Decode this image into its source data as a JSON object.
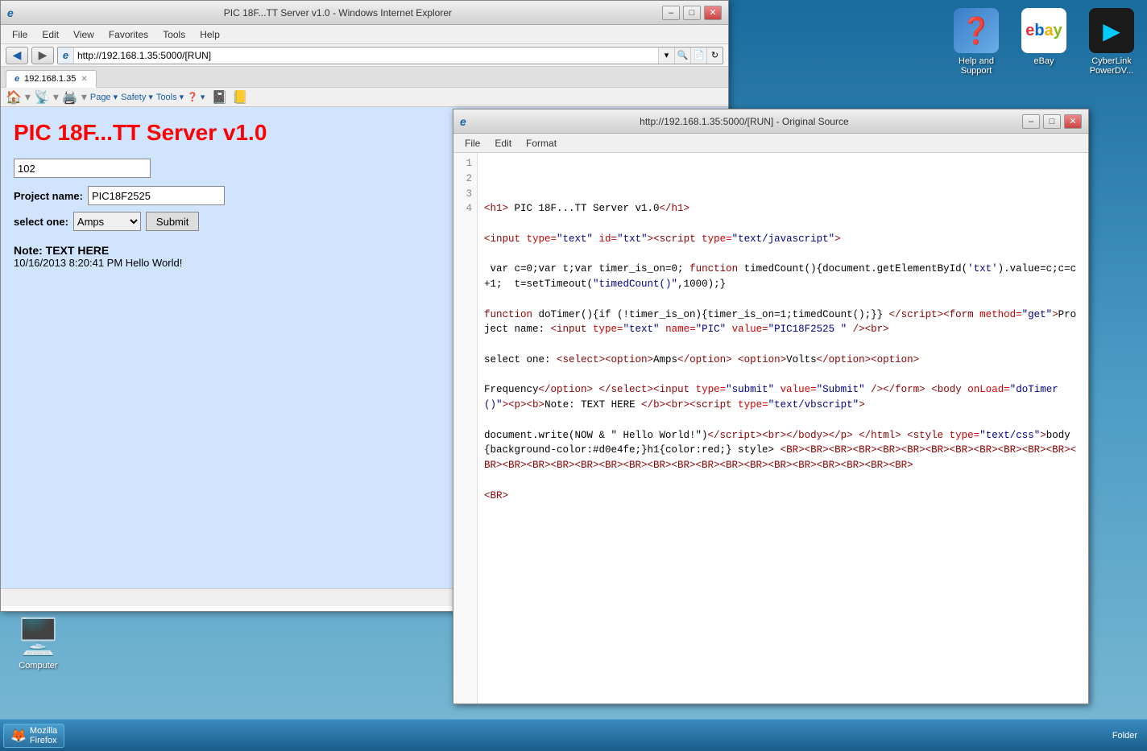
{
  "desktop": {
    "icons_top": [
      {
        "id": "help-support",
        "label": "Help and\nSupport",
        "emoji": "❓",
        "bg": "#3a7cc7"
      },
      {
        "id": "ebay",
        "label": "eBay",
        "text": "eBay",
        "bg": "#fff"
      },
      {
        "id": "cyberlink",
        "label": "CyberLink\nPowerDV...",
        "emoji": "▶",
        "bg": "#1a1a1a"
      }
    ],
    "icon_bottom": {
      "label": "Computer"
    }
  },
  "browser": {
    "title": "PIC 18F...TT Server v1.0 - Windows Internet Explorer",
    "url": "http://192.168.1.35:5000/[RUN]",
    "tab1_label": "192.168.1.35",
    "menu": [
      "File",
      "Edit",
      "View",
      "Favorites",
      "Tools",
      "Help"
    ],
    "fav_bar": [
      "Page ▾",
      "Safety ▾",
      "Tools ▾",
      "❓ ▾"
    ],
    "page": {
      "title": "PIC 18F...TT Server v1.0",
      "counter": "102",
      "project_label": "Project name:",
      "project_value": "PIC18F2525",
      "select_label": "select one:",
      "select_option": "Amps",
      "submit_label": "Submit",
      "note_label": "Note: TEXT HERE",
      "note_date": "10/16/2013 8:20:41 PM Hello World!"
    }
  },
  "source": {
    "title": "http://192.168.1.35:5000/[RUN] - Original Source",
    "menu": [
      "File",
      "Edit",
      "Format"
    ],
    "lines": [
      {
        "num": 1,
        "html": ""
      },
      {
        "num": 2,
        "html": "&lt;h1&gt; PIC 18F...TT Server v1.0&lt;/h1&gt;"
      },
      {
        "num": 3,
        "html": "&lt;input type=&quot;text&quot; id=&quot;txt&quot;&gt;&lt;script type=&quot;text/javascript&quot;&gt;"
      },
      {
        "num": 4,
        "html": " var c=0;var t;var timer_is_on=0; function timedCount(){document.getElementById(&apos;txt&apos;).value=c;c=c+1;  t=setTimeout(&quot;timedCount()&quot;,1000);}function doTimer(){if (!timer_is_on){timer_is_on=1;timedCount();}} &lt;/script&gt;&lt;form method=&quot;get&quot;&gt;Project name: &lt;input type=&quot;text&quot; name=&quot;PIC&quot; value=&quot;PIC18F2525 &quot; /&gt;&lt;br&gt;select one: &lt;select&gt;&lt;option&gt;Amps&lt;/option&gt; &lt;option&gt;Volts&lt;/option&gt;&lt;option&gt;Frequency&lt;/option&gt; &lt;/select&gt;&lt;input type=&quot;submit&quot; value=&quot;Submit&quot; /&gt;&lt;/form&gt; &lt;body onLoad=&quot;doTimer()&quot;&gt;&lt;p&gt;&lt;b&gt;Note: TEXT HERE &lt;/b&gt;&lt;br&gt;&lt;script type=&quot;text/vbscript&quot;&gt;document.write(NOW &amp; &quot; Hello World!&quot;)&lt;/script&gt;&lt;br&gt;&lt;/body&gt;&lt;/p&gt; &lt;/html&gt; &lt;style type=&quot;text/css&quot;&gt;body{background-color:#d0e4fe;}h1{color:red;} style&gt; &lt;BR&gt;&lt;BR&gt;&lt;BR&gt;&lt;BR&gt;&lt;BR&gt;&lt;BR&gt;&lt;BR&gt;&lt;BR&gt;&lt;BR&gt;&lt;BR&gt;&lt;BR&gt;&lt;BR&gt;&lt;BR&gt;&lt;BR&gt;&lt;BR&gt;&lt;BR&gt;&lt;BR&gt;&lt;BR&gt;&lt;BR&gt;&lt;BR&gt;&lt;BR&gt;&lt;BR&gt;&lt;BR&gt;&lt;BR&gt;&lt;BR&gt;&lt;BR&gt;&lt;BR&gt;&lt;BR&gt;&lt;BR&gt;&lt;BR&gt;"
      }
    ]
  },
  "taskbar": {
    "items": [
      {
        "label": "Mozilla\nFirefox",
        "icon": "🦊"
      }
    ],
    "right_text": "Folder"
  }
}
